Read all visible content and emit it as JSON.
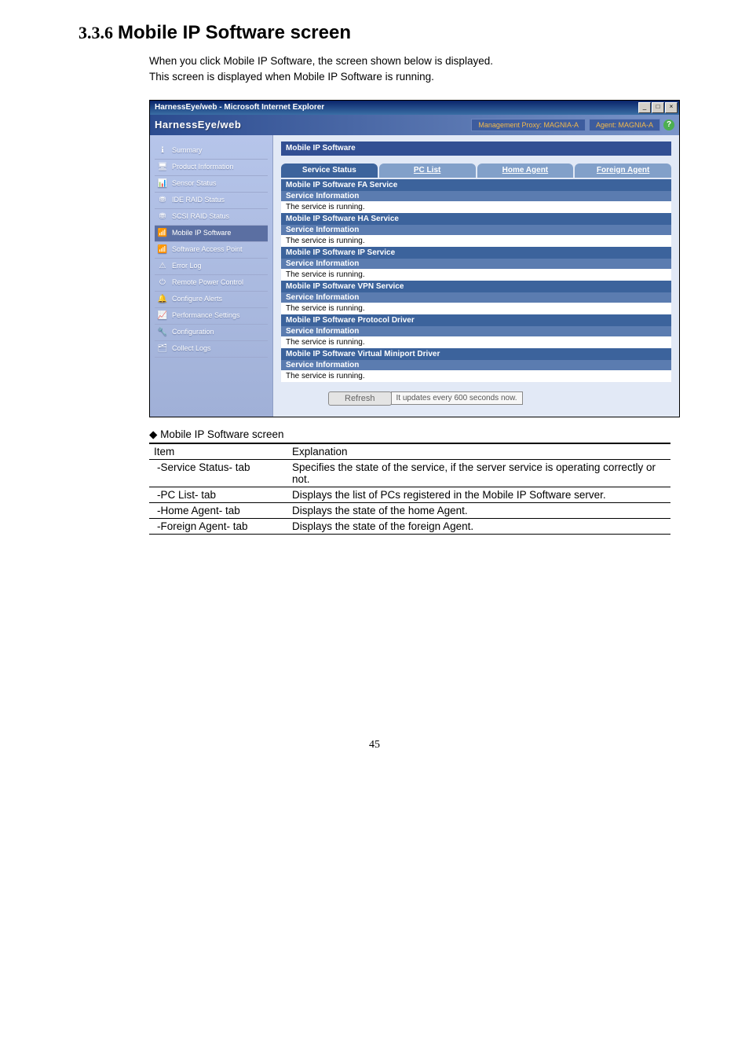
{
  "heading": {
    "number": "3.3.6",
    "title": "Mobile IP Software screen"
  },
  "intro_lines": [
    "When you click Mobile IP Software, the screen shown below is displayed.",
    "This screen is displayed when Mobile IP Software is running."
  ],
  "ie": {
    "title": "HarnessEye/web - Microsoft Internet Explorer",
    "min": "_",
    "max": "□",
    "close": "×"
  },
  "app": {
    "logo": "HarnessEye/web",
    "proxy_box": "Management Proxy: MAGNIA-A",
    "agent_box": "Agent: MAGNIA-A",
    "help": "?"
  },
  "sidebar": [
    {
      "icon": "ℹ",
      "label": "Summary",
      "name": "sidebar-item-summary"
    },
    {
      "icon": "🖥",
      "label": "Product Information",
      "name": "sidebar-item-product-information"
    },
    {
      "icon": "📊",
      "label": "Sensor Status",
      "name": "sidebar-item-sensor-status"
    },
    {
      "icon": "⛃",
      "label": "IDE RAID Status",
      "name": "sidebar-item-ide-raid-status"
    },
    {
      "icon": "⛃",
      "label": "SCSI RAID Status",
      "name": "sidebar-item-scsi-raid-status"
    },
    {
      "icon": "📶",
      "label": "Mobile IP Software",
      "name": "sidebar-item-mobile-ip-software",
      "active": true
    },
    {
      "icon": "📶",
      "label": "Software Access Point",
      "name": "sidebar-item-software-access-point"
    },
    {
      "icon": "⚠",
      "label": "Error Log",
      "name": "sidebar-item-error-log"
    },
    {
      "icon": "⏻",
      "label": "Remote Power Control",
      "name": "sidebar-item-remote-power-control"
    },
    {
      "icon": "🔔",
      "label": "Configure Alerts",
      "name": "sidebar-item-configure-alerts"
    },
    {
      "icon": "📈",
      "label": "Performance Settings",
      "name": "sidebar-item-performance-settings"
    },
    {
      "icon": "🔧",
      "label": "Configuration",
      "name": "sidebar-item-configuration"
    },
    {
      "icon": "🗂",
      "label": "Collect Logs",
      "name": "sidebar-item-collect-logs"
    }
  ],
  "content": {
    "title": "Mobile IP Software",
    "tabs": [
      {
        "label": "Service Status",
        "active": true,
        "name": "tab-service-status"
      },
      {
        "label": "PC List",
        "active": false,
        "name": "tab-pc-list"
      },
      {
        "label": "Home Agent",
        "active": false,
        "name": "tab-home-agent"
      },
      {
        "label": "Foreign Agent",
        "active": false,
        "name": "tab-foreign-agent"
      }
    ],
    "service_info_label": "Service Information",
    "running_text": "The service is running.",
    "services": [
      "Mobile IP Software FA Service",
      "Mobile IP Software HA Service",
      "Mobile IP Software IP Service",
      "Mobile IP Software VPN Service",
      "Mobile IP Software Protocol Driver",
      "Mobile IP Software Virtual Miniport Driver"
    ],
    "refresh_label": "Refresh",
    "refresh_note": "It updates every 600 seconds now."
  },
  "table": {
    "caption_prefix": "◆",
    "caption": "Mobile IP Software screen",
    "headers": {
      "item": "Item",
      "explanation": "Explanation"
    },
    "rows": [
      {
        "item": "-Service Status- tab",
        "explanation": "Specifies the state of the service, if the server service is operating correctly or not."
      },
      {
        "item": "-PC List- tab",
        "explanation": "Displays the list of PCs registered in the Mobile IP Software server."
      },
      {
        "item": "-Home Agent- tab",
        "explanation": "Displays the state of the home Agent."
      },
      {
        "item": "-Foreign Agent- tab",
        "explanation": "Displays the state of the foreign Agent."
      }
    ]
  },
  "page_number": "45"
}
